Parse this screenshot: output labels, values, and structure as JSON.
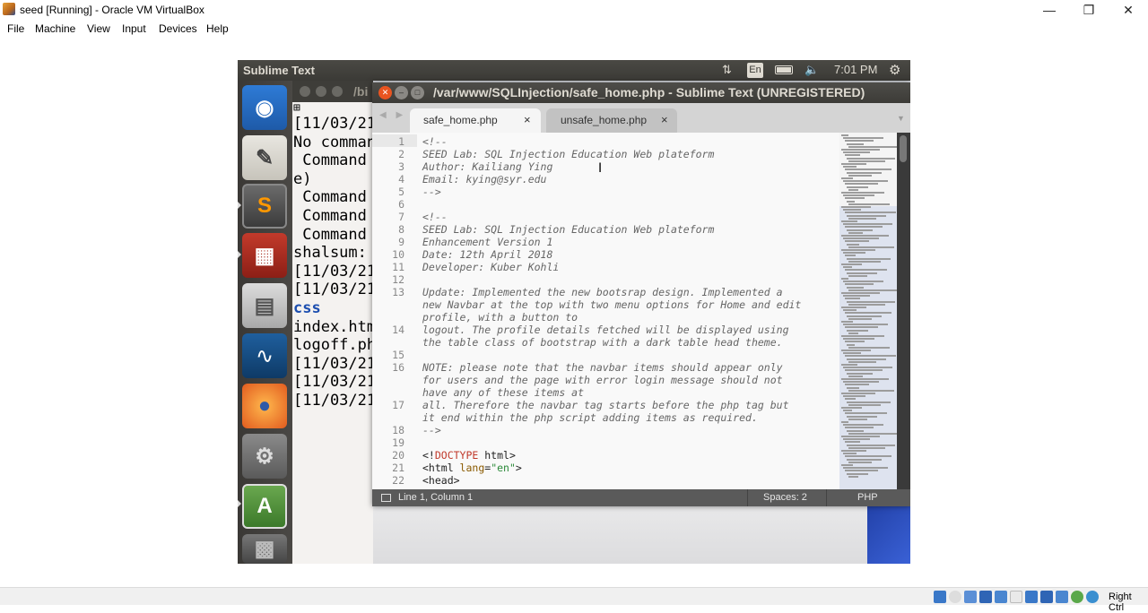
{
  "host": {
    "title": "seed [Running] - Oracle VM VirtualBox",
    "menu": [
      "File",
      "Machine",
      "View",
      "Input",
      "Devices",
      "Help"
    ],
    "status_right": "Right Ctrl"
  },
  "guest_topbar": {
    "app_name": "Sublime Text",
    "keyboard_lang": "En",
    "time": "7:01 PM"
  },
  "terminal": {
    "title_path": "/bi",
    "lines": [
      "[11/03/21",
      "No comman",
      " Command ",
      "e)",
      " Command ",
      " Command ",
      " Command ",
      "shalsum: ",
      "[11/03/21",
      "[11/03/21",
      "css",
      "index.htm",
      "logoff.ph",
      "[11/03/21",
      "[11/03/21",
      "[11/03/21"
    ]
  },
  "sublime": {
    "title": "/var/www/SQLInjection/safe_home.php - Sublime Text (UNREGISTERED)",
    "tabs": [
      {
        "label": "safe_home.php",
        "active": true
      },
      {
        "label": "unsafe_home.php",
        "active": false
      }
    ],
    "code_lines": [
      {
        "n": "1",
        "text": "<!--"
      },
      {
        "n": "2",
        "text": "SEED Lab: SQL Injection Education Web plateform"
      },
      {
        "n": "3",
        "text": "Author: Kailiang Ying"
      },
      {
        "n": "4",
        "text": "Email: kying@syr.edu"
      },
      {
        "n": "5",
        "text": "-->"
      },
      {
        "n": "6",
        "text": ""
      },
      {
        "n": "7",
        "text": "<!--"
      },
      {
        "n": "8",
        "text": "SEED Lab: SQL Injection Education Web plateform"
      },
      {
        "n": "9",
        "text": "Enhancement Version 1"
      },
      {
        "n": "10",
        "text": "Date: 12th April 2018"
      },
      {
        "n": "11",
        "text": "Developer: Kuber Kohli"
      },
      {
        "n": "12",
        "text": ""
      },
      {
        "n": "13",
        "text": "Update: Implemented the new bootsrap design. Implemented a"
      },
      {
        "n": "",
        "text": "new Navbar at the top with two menu options for Home and edit"
      },
      {
        "n": "",
        "text": "profile, with a button to"
      },
      {
        "n": "14",
        "text": "logout. The profile details fetched will be displayed using"
      },
      {
        "n": "",
        "text": "the table class of bootstrap with a dark table head theme."
      },
      {
        "n": "15",
        "text": ""
      },
      {
        "n": "16",
        "text": "NOTE: please note that the navbar items should appear only"
      },
      {
        "n": "",
        "text": "for users and the page with error login message should not"
      },
      {
        "n": "",
        "text": "have any of these items at"
      },
      {
        "n": "17",
        "text": "all. Therefore the navbar tag starts before the php tag but"
      },
      {
        "n": "",
        "text": "it end within the php script adding items as required."
      },
      {
        "n": "18",
        "text": "-->"
      },
      {
        "n": "19",
        "text": ""
      },
      {
        "n": "20",
        "text": "<!DOCTYPE html>"
      },
      {
        "n": "21",
        "text": "<html lang=\"en\">"
      },
      {
        "n": "22",
        "text": "<head>"
      }
    ],
    "status": {
      "position": "Line 1, Column 1",
      "spaces": "Spaces: 2",
      "syntax": "PHP"
    }
  }
}
